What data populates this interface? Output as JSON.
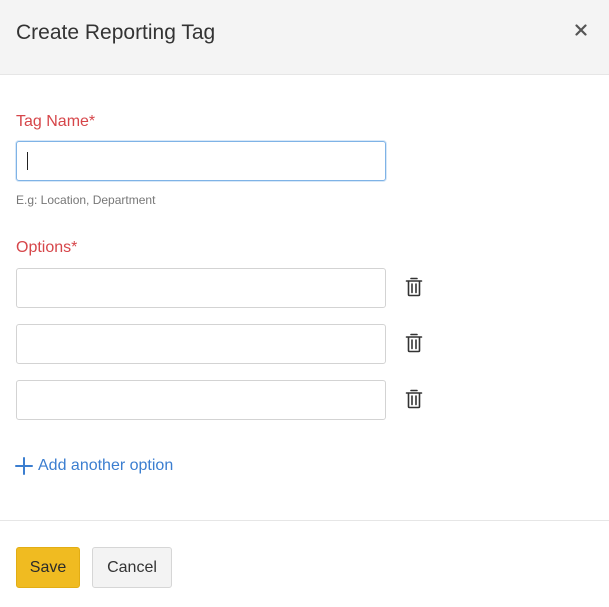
{
  "dialog": {
    "title": "Create Reporting Tag",
    "close_icon": "close-icon"
  },
  "tag_name": {
    "label": "Tag Name*",
    "value": "",
    "help_text": "E.g: Location, Department"
  },
  "options": {
    "label": "Options*",
    "items": [
      {
        "value": ""
      },
      {
        "value": ""
      },
      {
        "value": ""
      }
    ],
    "delete_icon": "trash-icon",
    "add_icon": "plus-icon",
    "add_label": "Add another option"
  },
  "footer": {
    "save_label": "Save",
    "cancel_label": "Cancel"
  },
  "colors": {
    "required_label": "#d6464a",
    "link": "#3b7ed0",
    "primary_button": "#f0bb21",
    "focus_border": "#7fb3e6"
  }
}
